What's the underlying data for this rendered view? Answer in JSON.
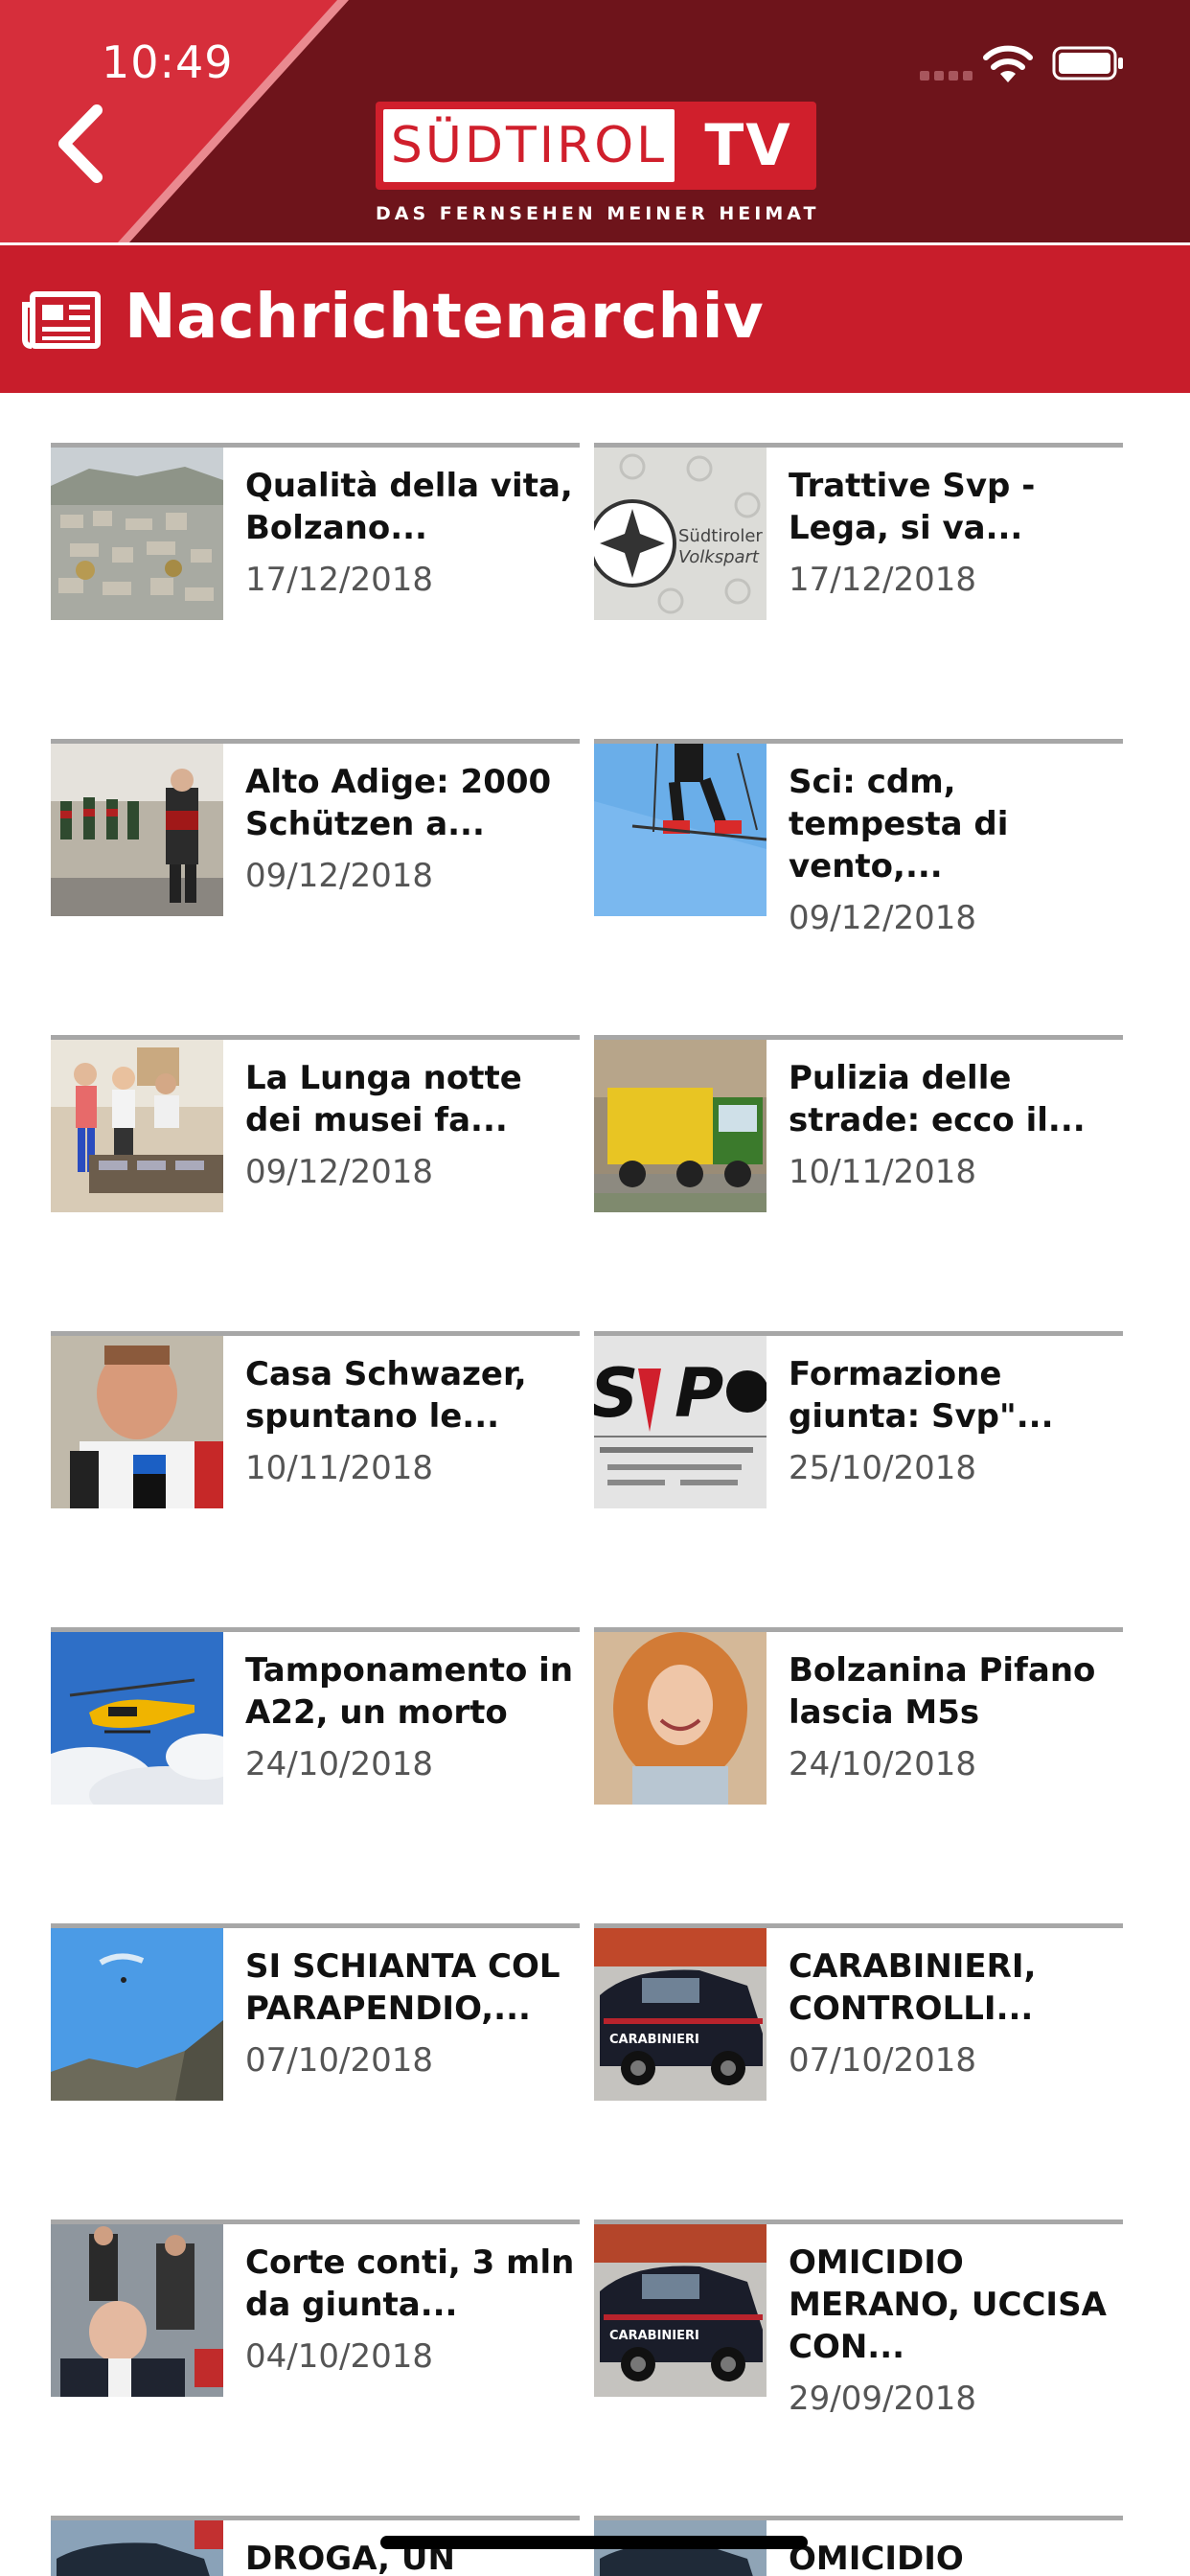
{
  "status_bar": {
    "time": "10:49"
  },
  "header": {
    "logo_left": "SÜDTIROL",
    "logo_right": "TV",
    "tagline": "DAS FERNSEHEN MEINER HEIMAT"
  },
  "title_bar": {
    "title": "Nachrichtenarchiv"
  },
  "colors": {
    "header_dark": "#6e141b",
    "accent_red": "#c81d2b",
    "card_rule": "#a7a7a7"
  },
  "articles": [
    {
      "title": "Qualità della vita, Bolzano...",
      "date": "17/12/2018"
    },
    {
      "title": "Trattive Svp - Lega, si va...",
      "date": "17/12/2018"
    },
    {
      "title": "Alto Adige: 2000 Schützen a...",
      "date": "09/12/2018"
    },
    {
      "title": "Sci: cdm, tempesta di vento,...",
      "date": "09/12/2018"
    },
    {
      "title": "La Lunga notte dei musei fa...",
      "date": "09/12/2018"
    },
    {
      "title": "Pulizia delle strade: ecco il...",
      "date": "10/11/2018"
    },
    {
      "title": "Casa Schwazer, spuntano le...",
      "date": "10/11/2018"
    },
    {
      "title": "Formazione giunta: Svp\"...",
      "date": "25/10/2018"
    },
    {
      "title": "Tamponamento in A22, un morto",
      "date": "24/10/2018"
    },
    {
      "title": "Bolzanina Pifano lascia M5s",
      "date": "24/10/2018"
    },
    {
      "title": "SI SCHIANTA COL PARAPENDIO,...",
      "date": "07/10/2018"
    },
    {
      "title": "CARABINIERI, CONTROLLI...",
      "date": "07/10/2018"
    },
    {
      "title": "Corte conti, 3 mln da giunta...",
      "date": "04/10/2018"
    },
    {
      "title": "OMICIDIO MERANO, UCCISA CON...",
      "date": "29/09/2018"
    },
    {
      "title": "DROGA, UN",
      "date": ""
    },
    {
      "title": "OMICIDIO",
      "date": ""
    }
  ]
}
